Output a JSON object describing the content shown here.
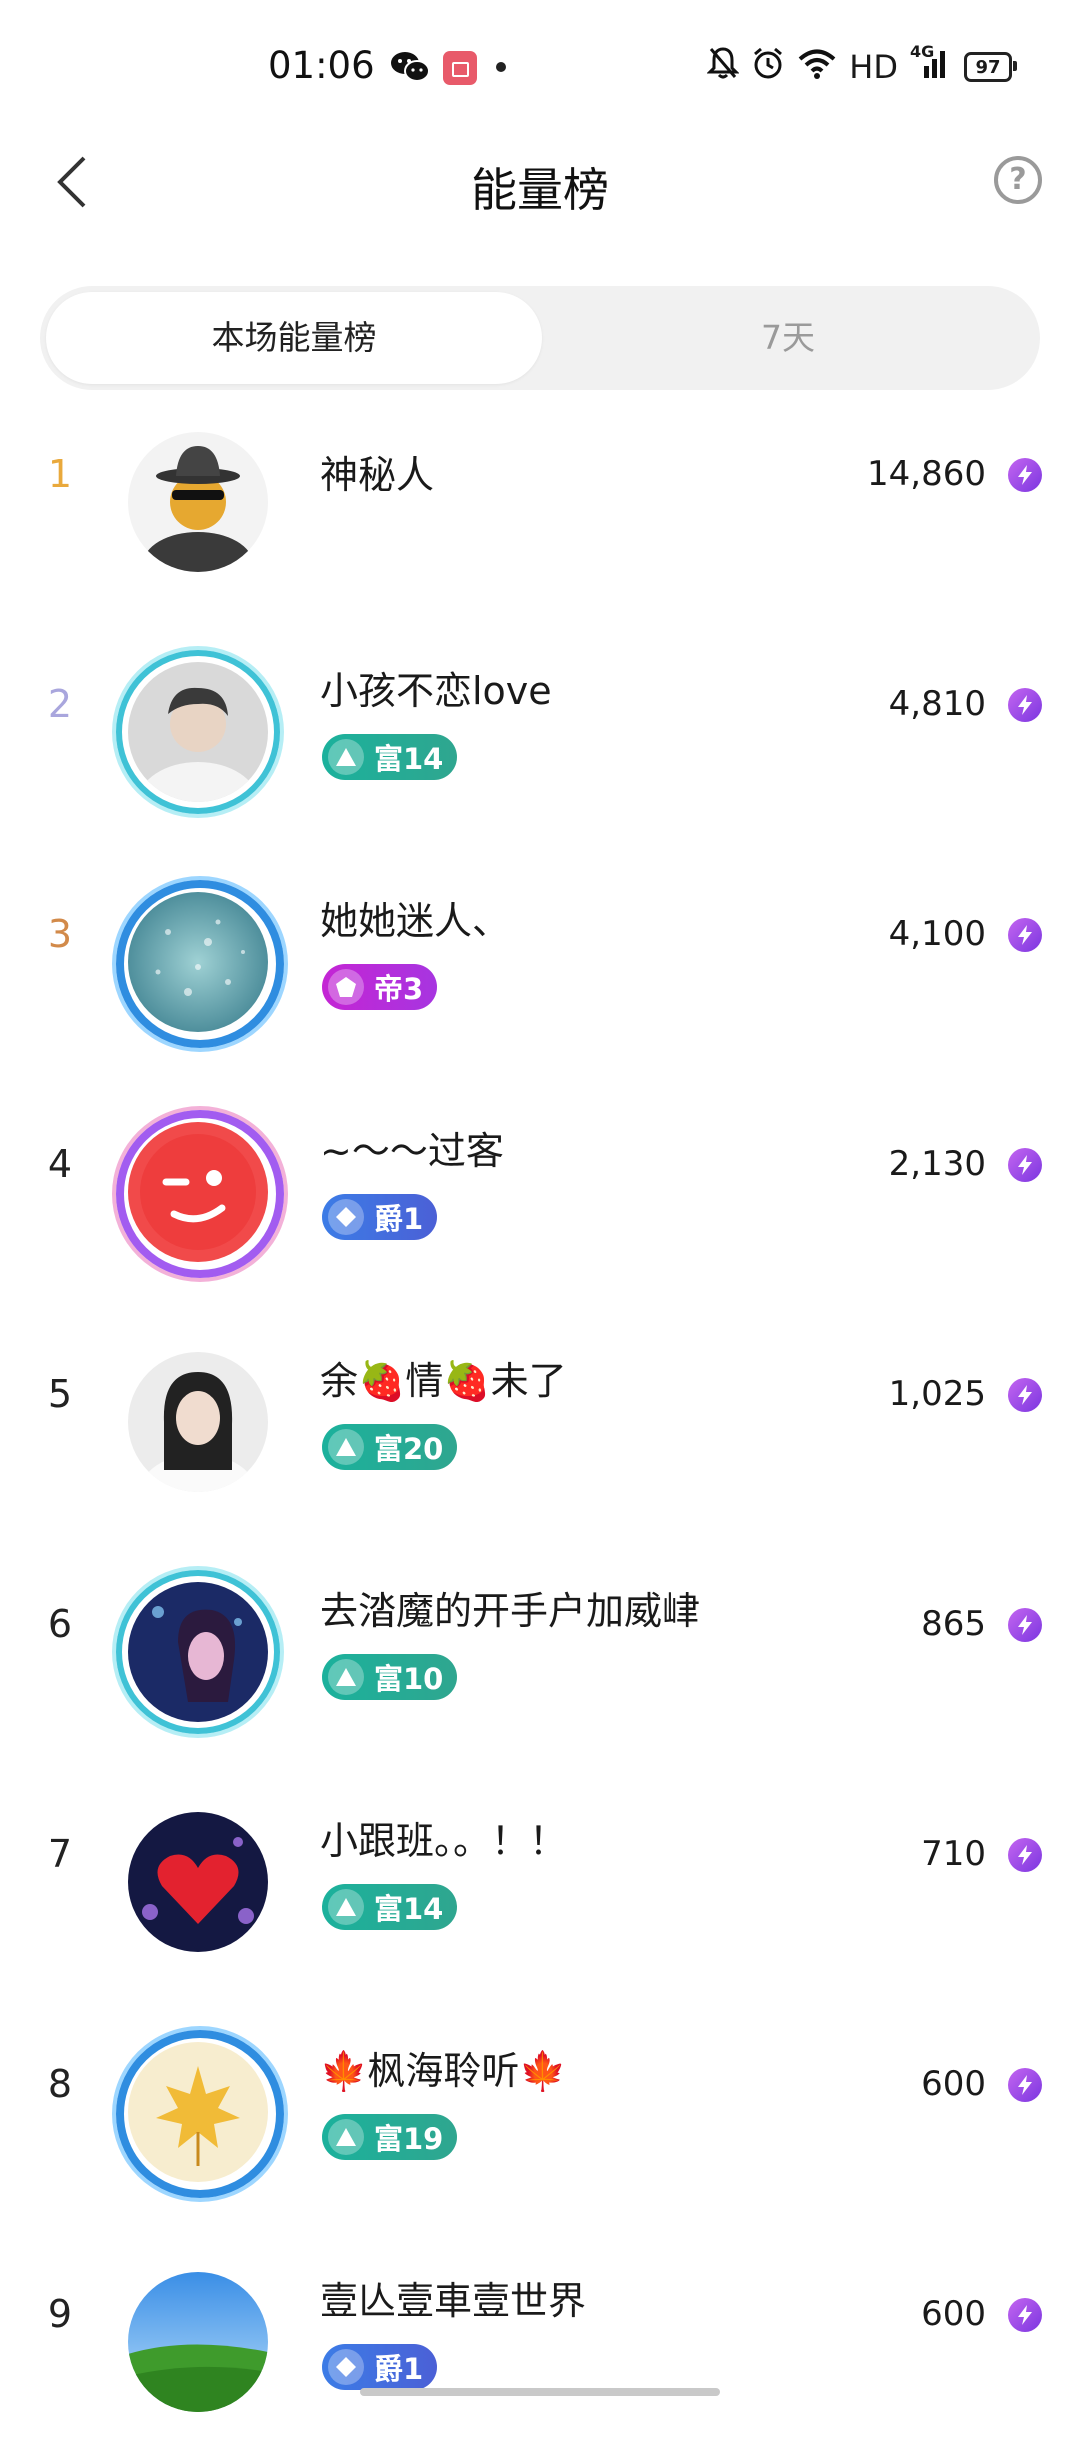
{
  "status_bar": {
    "time": "01:06",
    "network": "HD",
    "signal_label": "4G",
    "battery": "97"
  },
  "header": {
    "title": "能量榜",
    "back_icon": "chevron-left-icon",
    "help_icon": "question-circle-icon",
    "help_glyph": "?"
  },
  "tabs": [
    {
      "label": "本场能量榜",
      "active": true
    },
    {
      "label": "7天",
      "active": false
    }
  ],
  "colors": {
    "rank1": "#e9a93c",
    "rank2": "#a9a6dd",
    "rank3": "#d28a4a",
    "rank_default": "#222222",
    "energy_icon": "#9b48e8"
  },
  "ranking": [
    {
      "rank": "1",
      "name": "神秘人",
      "badge": null,
      "score": "14,860",
      "avatar": "mystery-man"
    },
    {
      "rank": "2",
      "name": "小孩不恋love",
      "badge": {
        "type": "fu",
        "text": "富14"
      },
      "score": "4,810",
      "avatar": "photo-man"
    },
    {
      "rank": "3",
      "name": "她她迷人、",
      "badge": {
        "type": "di",
        "text": "帝3"
      },
      "score": "4,100",
      "avatar": "water-drops"
    },
    {
      "rank": "4",
      "name": "~〜〜过客",
      "badge": {
        "type": "jue",
        "text": "爵1"
      },
      "score": "2,130",
      "avatar": "red-face"
    },
    {
      "rank": "5",
      "name": "余🍓情🍓未了",
      "badge": {
        "type": "fu",
        "text": "富20"
      },
      "score": "1,025",
      "avatar": "photo-woman"
    },
    {
      "rank": "6",
      "name": "去涾魔的开手户加威峍",
      "badge": {
        "type": "fu",
        "text": "富10"
      },
      "score": "865",
      "avatar": "photo-woman-blue"
    },
    {
      "rank": "7",
      "name": "小跟班。。！！",
      "badge": {
        "type": "fu",
        "text": "富14"
      },
      "score": "710",
      "avatar": "heart"
    },
    {
      "rank": "8",
      "name": "🍁枫海聆听🍁",
      "badge": {
        "type": "fu",
        "text": "富19"
      },
      "score": "600",
      "avatar": "maple-leaf"
    },
    {
      "rank": "9",
      "name": "壹亾壹車壹世界",
      "badge": {
        "type": "jue",
        "text": "爵1"
      },
      "score": "600",
      "avatar": "green-field"
    }
  ]
}
